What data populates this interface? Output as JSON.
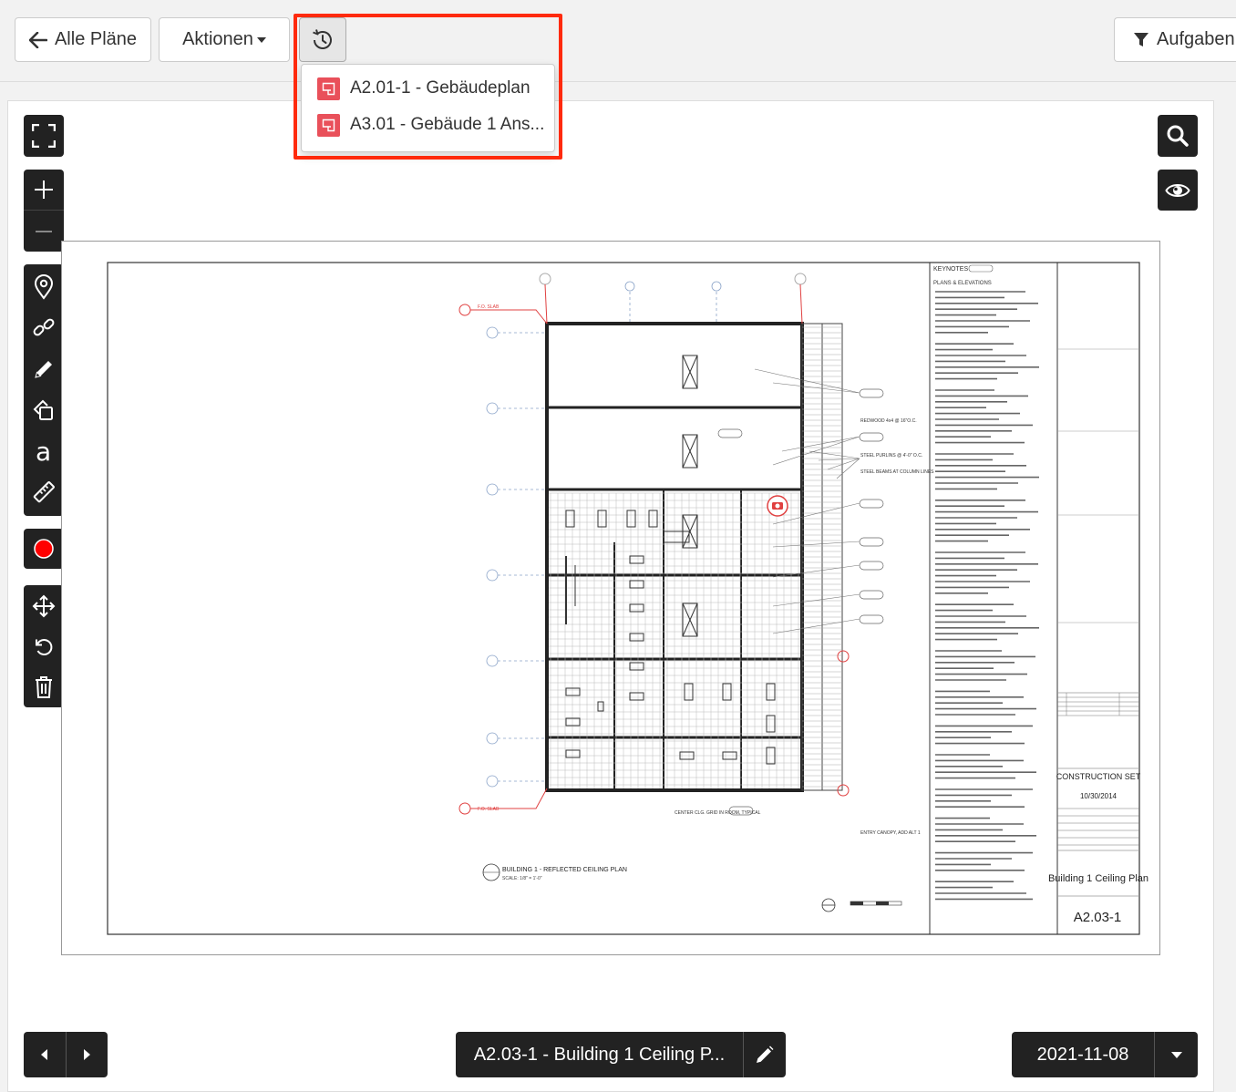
{
  "toolbar": {
    "back_label": "Alle Pläne",
    "actions_label": "Aktionen",
    "tasks_label": "Aufgaben f"
  },
  "history_dropdown": {
    "items": [
      {
        "label": "A2.01-1 - Gebäudeplan"
      },
      {
        "label": "A3.01 - Gebäude 1 Ans..."
      }
    ]
  },
  "drawing": {
    "keynotes_title": "KEYNOTES",
    "keynotes_subtitle": "PLANS & ELEVATIONS",
    "title": "BUILDING 1 - REFLECTED CEILING PLAN",
    "scale": "SCALE: 1/8\" = 1'-0\"",
    "set_name": "CONSTRUCTION SET",
    "set_date": "10/30/2014",
    "sheet_title": "Building 1 Ceiling Plan",
    "sheet_number": "A2.03-1",
    "labels": {
      "fo_slab": "F.O. SLAB",
      "redwood": "REDWOOD 4x4 @ 16\"O.C.",
      "steel_purlins": "STEEL PURLINS @ 4'-0\" O.C.",
      "steel_beams": "STEEL BEAMS AT COLUMN LINES",
      "center_clg": "CENTER CLG. GRID IN ROOM, TYPICAL",
      "entry_canopy": "ENTRY CANOPY, ADD ALT 1",
      "typ": "TYP"
    }
  },
  "footer": {
    "plan_name": "A2.03-1 - Building 1 Ceiling P...",
    "date": "2021-11-08"
  },
  "colors": {
    "highlight": "#ff2a0d",
    "plan_icon": "#e9505a",
    "toolbar_dark": "#222222",
    "record": "#ff0000"
  }
}
